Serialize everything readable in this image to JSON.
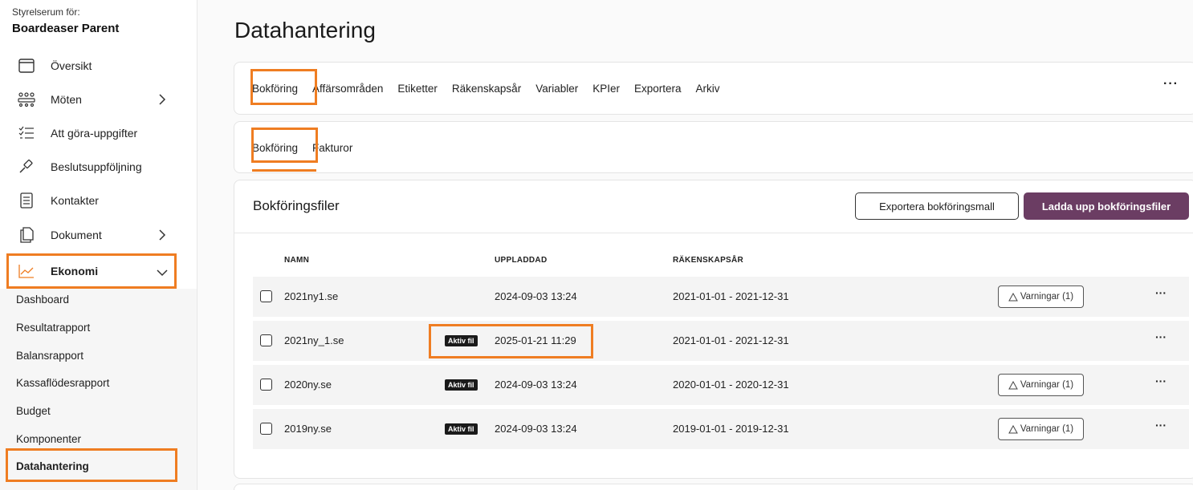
{
  "sidebar": {
    "org_subtitle": "Styrelserum för:",
    "org_name": "Boardeaser Parent",
    "items": [
      {
        "label": "Översikt",
        "icon": "calendar-icon"
      },
      {
        "label": "Möten",
        "icon": "meeting-icon"
      },
      {
        "label": "Att göra-uppgifter",
        "icon": "checklist-icon"
      },
      {
        "label": "Beslutsuppföljning",
        "icon": "gavel-icon"
      },
      {
        "label": "Kontakter",
        "icon": "contacts-icon"
      },
      {
        "label": "Dokument",
        "icon": "document-icon"
      },
      {
        "label": "Ekonomi",
        "icon": "chart-icon"
      }
    ],
    "economy_sub": [
      "Dashboard",
      "Resultatrapport",
      "Balansrapport",
      "Kassaflödesrapport",
      "Budget",
      "Komponenter",
      "Datahantering"
    ]
  },
  "page": {
    "title": "Datahantering"
  },
  "main_tabs": [
    "Bokföring",
    "Affärsområden",
    "Etiketter",
    "Räkenskapsår",
    "Variabler",
    "KPIer",
    "Exportera",
    "Arkiv"
  ],
  "sub_tabs": [
    "Bokföring",
    "Fakturor"
  ],
  "files": {
    "title": "Bokföringsfiler",
    "export_button": "Exportera bokföringsmall",
    "upload_button": "Ladda upp bokföringsfiler",
    "columns": {
      "name": "NAMN",
      "uploaded": "UPPLADDAD",
      "fiscal_year": "RÄKENSKAPSÅR"
    },
    "active_badge": "Aktiv fil",
    "warnings_label": "Varningar (1)",
    "rows": [
      {
        "name": "2021ny1.se",
        "uploaded": "2024-09-03 13:24",
        "fiscal_year": "2021-01-01 - 2021-12-31"
      },
      {
        "name": "2021ny_1.se",
        "uploaded": "2025-01-21 11:29",
        "fiscal_year": "2021-01-01 - 2021-12-31"
      },
      {
        "name": "2020ny.se",
        "uploaded": "2024-09-03 13:24",
        "fiscal_year": "2020-01-01 - 2020-12-31"
      },
      {
        "name": "2019ny.se",
        "uploaded": "2024-09-03 13:24",
        "fiscal_year": "2019-01-01 - 2019-12-31"
      }
    ]
  },
  "colors": {
    "accent": "#6b3d63",
    "highlight": "#ef7d22"
  }
}
